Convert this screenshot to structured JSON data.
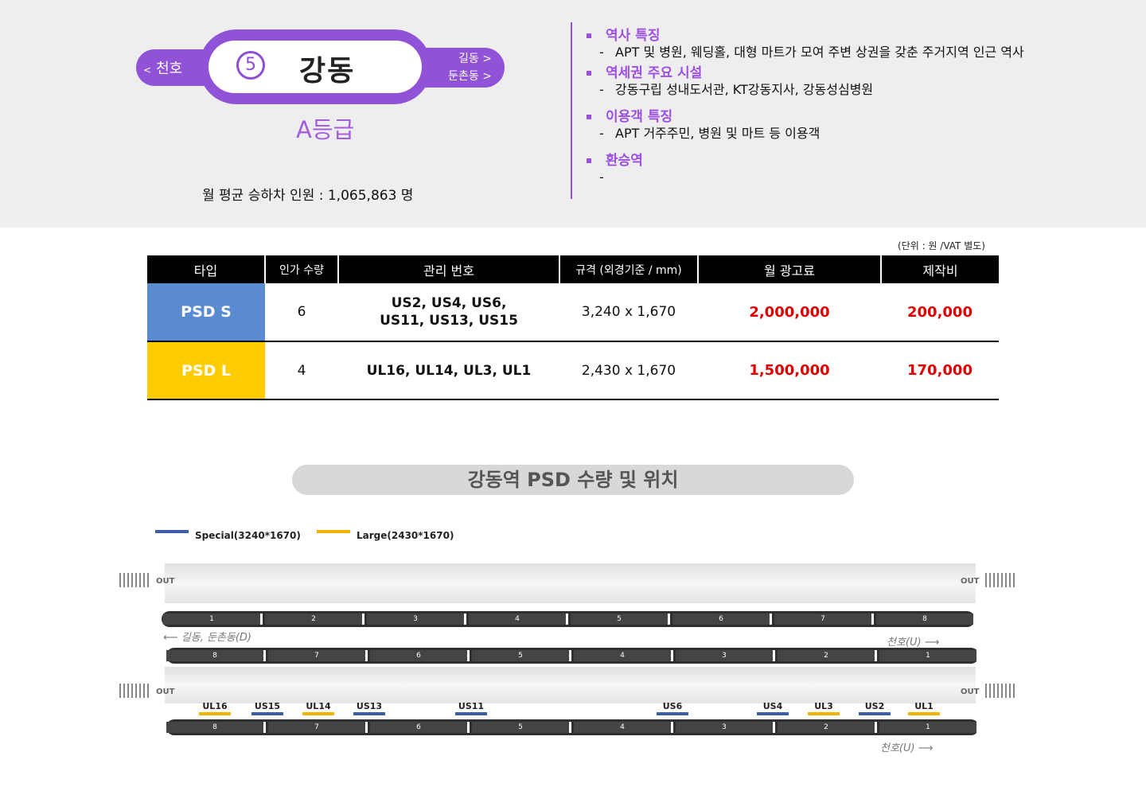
{
  "header": {
    "prev_station": "천호",
    "prev_arrow": "<",
    "next_station_1": "길동 >",
    "next_station_2": "둔촌동 >",
    "line_number": "5",
    "station_name": "강동",
    "grade": "A등급",
    "monthly_riders": "월 평균 승하차 인원 :  1,065,863 명",
    "colors": {
      "line": "#9052d6",
      "heading": "#9c4fe0"
    }
  },
  "info": [
    {
      "heading": "역사 특징",
      "body": "APT 및 병원, 웨딩홀, 대형 마트가 모여 주변 상권을 갖춘 주거지역 인근 역사"
    },
    {
      "heading": "역세권 주요 시설",
      "body": "강동구립 성내도서관, KT강동지사, 강동성심병원"
    },
    {
      "heading": "이용객 특징",
      "body": "APT 거주주민, 병원 및 마트 등 이용객"
    },
    {
      "heading": "환승역",
      "body": ""
    }
  ],
  "table": {
    "unit_note": "(단위 : 원 /VAT 별도)",
    "headers": [
      "타입",
      "인가 수량",
      "관리 번호",
      "규격 (외경기준 / mm)",
      "월 광고료",
      "제작비"
    ],
    "rows": [
      {
        "type": "PSD S",
        "qty": "6",
        "codes": "US2, US4, US6, US11, US13, US15",
        "size": "3,240 x 1,670",
        "monthly": "2,000,000",
        "production": "200,000",
        "color": "#5a8ad0"
      },
      {
        "type": "PSD L",
        "qty": "4",
        "codes": "UL16, UL14, UL3, UL1",
        "size": "2,430 x 1,670",
        "monthly": "1,500,000",
        "production": "170,000",
        "color": "#ffcc00"
      }
    ]
  },
  "diagram": {
    "title": "강동역 PSD 수량 및 위치",
    "legend": [
      {
        "label": "Special(3240*1670)",
        "color": "#3a5ea8"
      },
      {
        "label": "Large(2430*1670)",
        "color": "#f0b400"
      }
    ],
    "out_label": "OUT",
    "dir_down": "길동, 둔촌동(D)",
    "dir_up": "천호(U)",
    "cars_asc": [
      "1",
      "2",
      "3",
      "4",
      "5",
      "6",
      "7",
      "8"
    ],
    "cars_desc": [
      "8",
      "7",
      "6",
      "5",
      "4",
      "3",
      "2",
      "1"
    ],
    "psd_labels": [
      "UL16",
      "US15",
      "UL14",
      "US13",
      "US11",
      "US6",
      "US4",
      "UL3",
      "US2",
      "UL1"
    ]
  }
}
